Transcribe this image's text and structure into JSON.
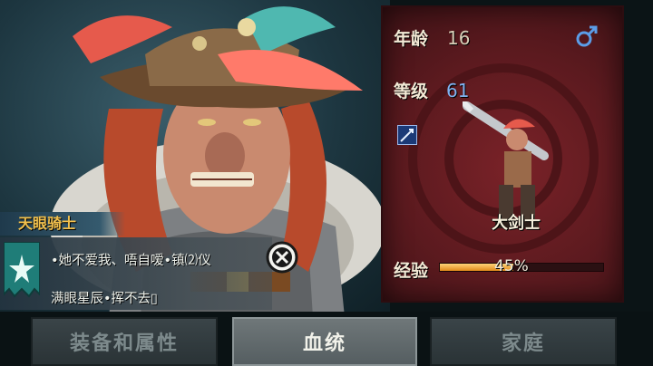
{
  "character": {
    "age_label": "年龄",
    "age_value": "16",
    "level_label": "等级",
    "level_value": "61",
    "gender": "male",
    "class_name": "大剑士",
    "xp_label": "经验",
    "xp_percent_text": "45%",
    "xp_fraction": 0.45
  },
  "trait": {
    "title": "天眼骑士",
    "line1": "•她不爱我、唔自嗳•镇⑵仪",
    "line2": "满眼星辰•挥不去▯"
  },
  "tabs": [
    {
      "label": "装备和属性",
      "active": false
    },
    {
      "label": "血统",
      "active": true
    },
    {
      "label": "家庭",
      "active": false
    }
  ],
  "colors": {
    "accent_gold": "#f1c04d",
    "level_blue": "#7fb2f0",
    "stats_panel_red": "#6a1d22",
    "xp_orange": "#e08a1a"
  },
  "icons": {
    "gender": "male-symbol-icon",
    "skill": "sword-skill-icon",
    "close": "close-x-icon",
    "trait": "star-banner-icon"
  }
}
